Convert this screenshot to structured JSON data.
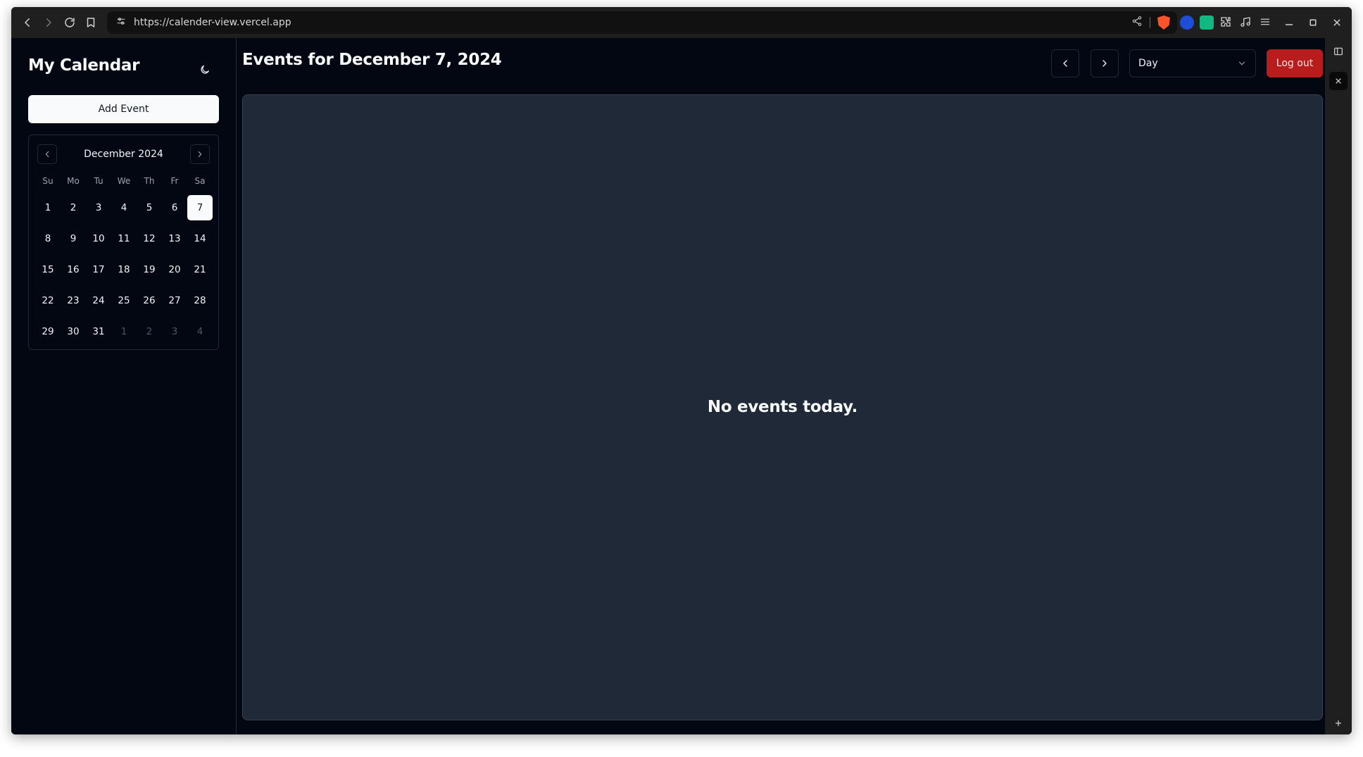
{
  "browser": {
    "url": "https://calender-view.vercel.app"
  },
  "sidebar": {
    "title": "My Calendar",
    "add_event_label": "Add Event",
    "mini_calendar": {
      "month_label": "December 2024",
      "weekdays": [
        "Su",
        "Mo",
        "Tu",
        "We",
        "Th",
        "Fr",
        "Sa"
      ],
      "days": [
        {
          "label": "1",
          "outside": false
        },
        {
          "label": "2",
          "outside": false
        },
        {
          "label": "3",
          "outside": false
        },
        {
          "label": "4",
          "outside": false
        },
        {
          "label": "5",
          "outside": false
        },
        {
          "label": "6",
          "outside": false
        },
        {
          "label": "7",
          "outside": false,
          "selected": true
        },
        {
          "label": "8",
          "outside": false
        },
        {
          "label": "9",
          "outside": false
        },
        {
          "label": "10",
          "outside": false
        },
        {
          "label": "11",
          "outside": false
        },
        {
          "label": "12",
          "outside": false
        },
        {
          "label": "13",
          "outside": false
        },
        {
          "label": "14",
          "outside": false
        },
        {
          "label": "15",
          "outside": false
        },
        {
          "label": "16",
          "outside": false
        },
        {
          "label": "17",
          "outside": false
        },
        {
          "label": "18",
          "outside": false
        },
        {
          "label": "19",
          "outside": false
        },
        {
          "label": "20",
          "outside": false
        },
        {
          "label": "21",
          "outside": false
        },
        {
          "label": "22",
          "outside": false
        },
        {
          "label": "23",
          "outside": false
        },
        {
          "label": "24",
          "outside": false
        },
        {
          "label": "25",
          "outside": false
        },
        {
          "label": "26",
          "outside": false
        },
        {
          "label": "27",
          "outside": false
        },
        {
          "label": "28",
          "outside": false
        },
        {
          "label": "29",
          "outside": false
        },
        {
          "label": "30",
          "outside": false
        },
        {
          "label": "31",
          "outside": false
        },
        {
          "label": "1",
          "outside": true
        },
        {
          "label": "2",
          "outside": true
        },
        {
          "label": "3",
          "outside": true
        },
        {
          "label": "4",
          "outside": true
        }
      ]
    }
  },
  "main": {
    "title": "Events for December 7, 2024",
    "view_select_value": "Day",
    "logout_label": "Log out",
    "empty_message": "No events today."
  },
  "colors": {
    "app_background": "#030712",
    "panel_background": "#1f2937",
    "logout_button": "#b91c1c"
  }
}
